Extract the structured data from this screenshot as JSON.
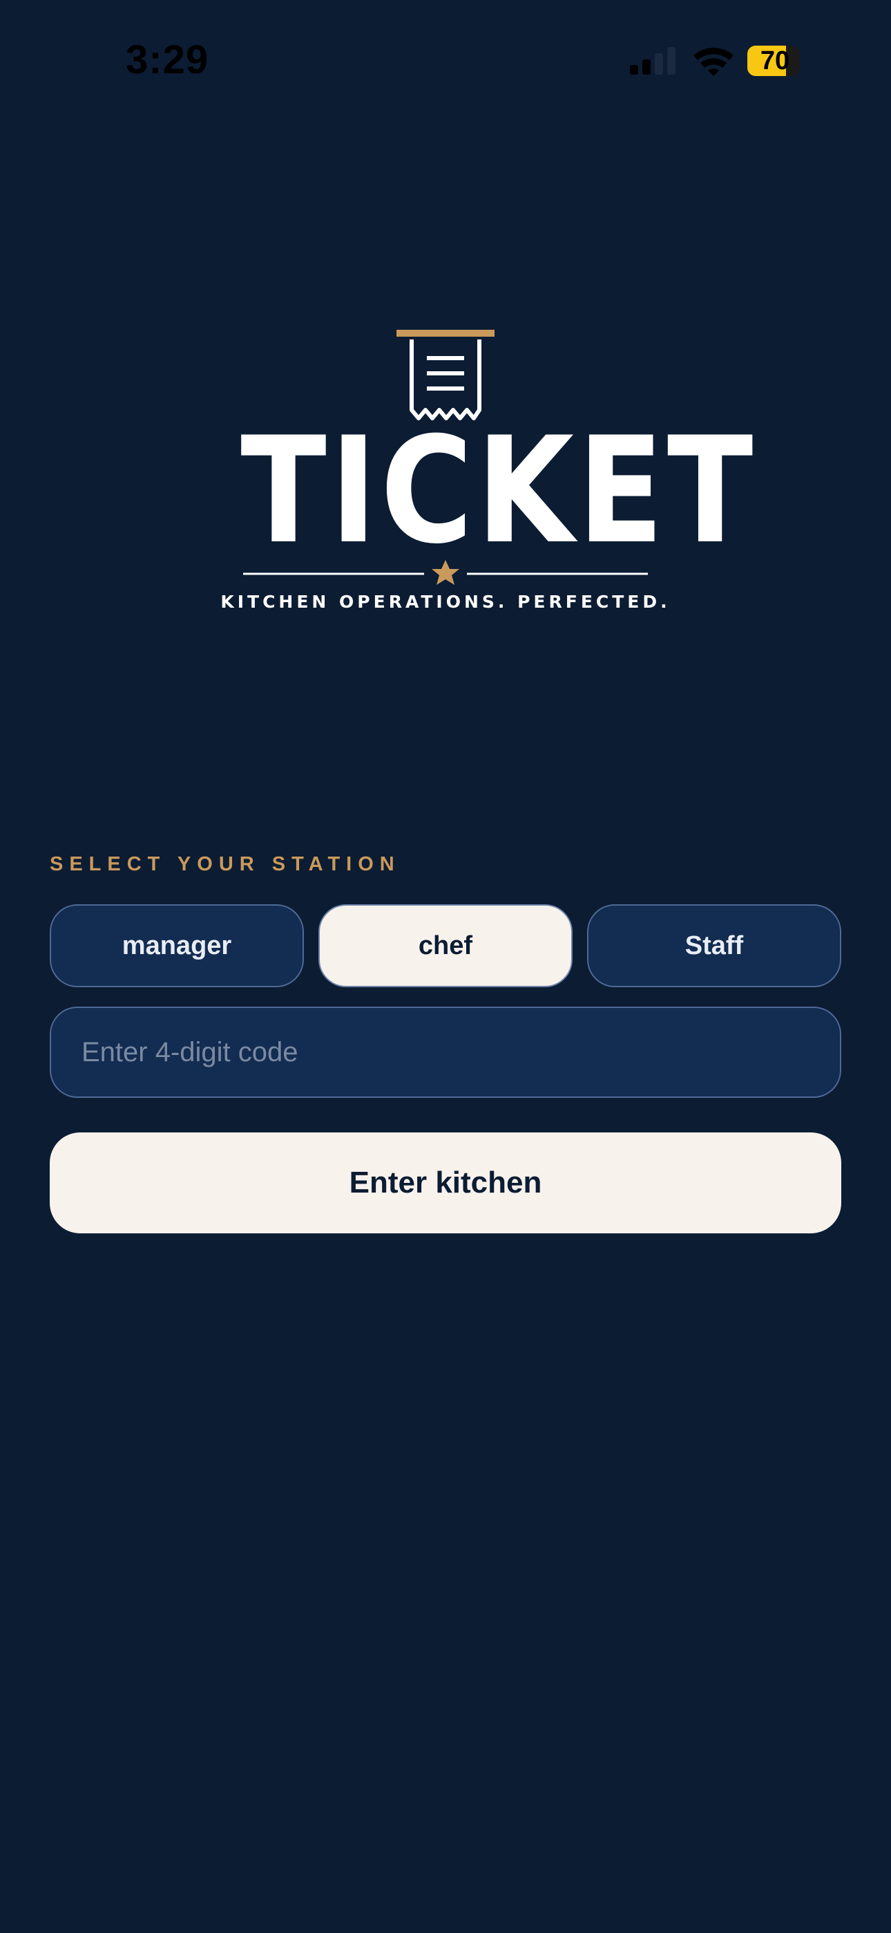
{
  "status_bar": {
    "time": "3:29",
    "battery": "70",
    "icons": [
      "signal-icon",
      "wifi-icon",
      "battery-icon"
    ]
  },
  "logo": {
    "wordmark": "TICKET",
    "tagline": "KITCHEN OPERATIONS. PERFECTED.",
    "icons": [
      "receipt-icon",
      "star-icon"
    ]
  },
  "login": {
    "station_label": "SELECT YOUR STATION",
    "stations": [
      {
        "label": "manager",
        "selected": false
      },
      {
        "label": "chef",
        "selected": true
      },
      {
        "label": "Staff",
        "selected": false
      }
    ],
    "code_placeholder": "Enter 4-digit code",
    "code_value": "",
    "submit_label": "Enter kitchen"
  },
  "colors": {
    "background": "#0c1c33",
    "accent_gold": "#c99a5b",
    "button_fill": "#132c51",
    "selected_fill": "#f7f2ec"
  }
}
